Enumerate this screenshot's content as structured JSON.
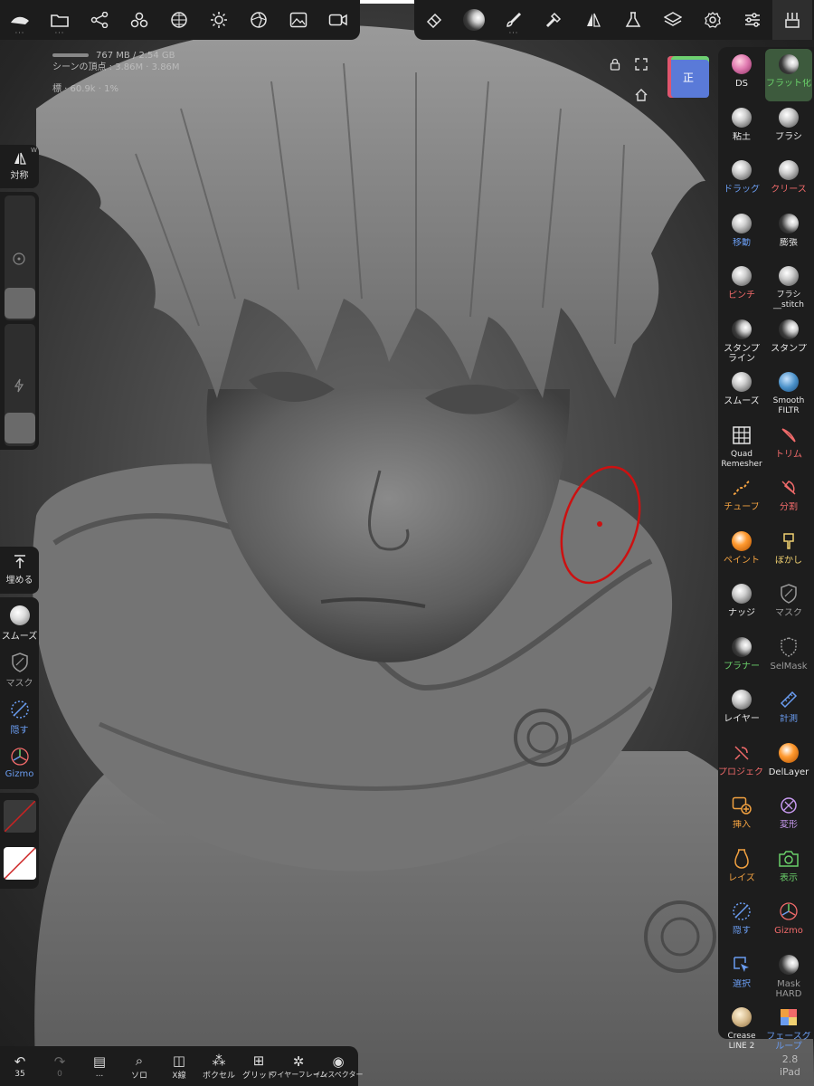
{
  "top_toolbar": {
    "left_buttons": [
      {
        "icon": "nomad-logo-icon",
        "has_more": true
      },
      {
        "icon": "folder-icon",
        "has_more": true
      },
      {
        "icon": "scene-tree-icon",
        "has_more": false
      },
      {
        "icon": "primitives-icon",
        "has_more": false
      },
      {
        "icon": "topology-icon",
        "has_more": false
      },
      {
        "icon": "light-icon",
        "has_more": false
      },
      {
        "icon": "render-icon",
        "has_more": false
      },
      {
        "icon": "background-image-icon",
        "has_more": false
      },
      {
        "icon": "camera-icon",
        "has_more": false
      }
    ],
    "right_buttons": [
      {
        "icon": "eraser-icon",
        "has_more": false
      },
      {
        "icon": "material-sphere-icon",
        "has_more": false
      },
      {
        "icon": "paint-brush-icon",
        "has_more": true
      },
      {
        "icon": "hammer-icon",
        "has_more": false
      },
      {
        "icon": "symmetry-icon",
        "has_more": false
      },
      {
        "icon": "flask-icon",
        "has_more": false
      },
      {
        "icon": "layers-icon",
        "has_more": false
      },
      {
        "icon": "settings-icon",
        "has_more": false
      },
      {
        "icon": "sliders-icon",
        "has_more": false
      },
      {
        "icon": "stroke-settings-icon",
        "has_more": false
      }
    ]
  },
  "stats": {
    "memory": "767 MB / 2.54 GB",
    "vertices_label": "シーンの頂点 : 3.86M · ",
    "vertices_value": "3.86M",
    "mesh": "標 · 60.9k · 1%"
  },
  "view": {
    "cube_label": "正"
  },
  "left_panel": {
    "symmetry_label": "対称",
    "symmetry_badge": "W",
    "fill_label": "埋める",
    "tools": [
      {
        "label": "スムーズ",
        "icon": "smooth-icon"
      },
      {
        "label": "マスク",
        "icon": "mask-icon"
      },
      {
        "label": "隠す",
        "icon": "hide-icon"
      },
      {
        "label": "Gizmo",
        "icon": "gizmo-icon"
      }
    ]
  },
  "right_tools": [
    {
      "label": "DS",
      "color": "#e8e8e8",
      "ball": "pink"
    },
    {
      "label": "フラット化",
      "color": "#6ad06a",
      "ball": "dark",
      "active": true
    },
    {
      "label": "粘土",
      "color": "#e8e8e8",
      "ball": "std"
    },
    {
      "label": "ブラシ",
      "color": "#e8e8e8",
      "ball": "std"
    },
    {
      "label": "ドラッグ",
      "color": "#6a9cf0",
      "ball": "std"
    },
    {
      "label": "クリース",
      "color": "#f06a6a",
      "ball": "std"
    },
    {
      "label": "移動",
      "color": "#6a9cf0",
      "ball": "std"
    },
    {
      "label": "膨張",
      "color": "#e8e8e8",
      "ball": "dark"
    },
    {
      "label": "ピンチ",
      "color": "#f06a6a",
      "ball": "std"
    },
    {
      "label": "ブラシ__stitch",
      "color": "#e8e8e8",
      "ball": "std"
    },
    {
      "label": "スタンプ ライン",
      "color": "#e8e8e8",
      "ball": "dark"
    },
    {
      "label": "スタンプ",
      "color": "#e8e8e8",
      "ball": "dark"
    },
    {
      "label": "スムーズ",
      "color": "#e8e8e8",
      "ball": "std"
    },
    {
      "label": "Smooth FILTR",
      "color": "#e8e8e8",
      "ball": "blue"
    },
    {
      "label": "Quad Remesher",
      "color": "#e8e8e8",
      "ball": "grid"
    },
    {
      "label": "トリム",
      "color": "#f06a6a",
      "ball": "trim"
    },
    {
      "label": "チューブ",
      "color": "#f0a040",
      "ball": "tube"
    },
    {
      "label": "分割",
      "color": "#f06a6a",
      "ball": "split"
    },
    {
      "label": "ペイント",
      "color": "#f0a040",
      "ball": "orange"
    },
    {
      "label": "ぼかし",
      "color": "#f0d070",
      "ball": "smudge"
    },
    {
      "label": "ナッジ",
      "color": "#e8e8e8",
      "ball": "std"
    },
    {
      "label": "マスク",
      "color": "#9a9a9a",
      "ball": "mask"
    },
    {
      "label": "プラナー",
      "color": "#6ad06a",
      "ball": "dark"
    },
    {
      "label": "SelMask",
      "color": "#9a9a9a",
      "ball": "selmask"
    },
    {
      "label": "レイヤー",
      "color": "#e8e8e8",
      "ball": "std"
    },
    {
      "label": "計測",
      "color": "#6a9cf0",
      "ball": "ruler"
    },
    {
      "label": "プロジェクト",
      "color": "#f06a6a",
      "ball": "project"
    },
    {
      "label": "DelLayer",
      "color": "#e8e8e8",
      "ball": "orange"
    },
    {
      "label": "挿入",
      "color": "#f0a040",
      "ball": "insert"
    },
    {
      "label": "変形",
      "color": "#c89af0",
      "ball": "transform"
    },
    {
      "label": "レイズ",
      "color": "#f0a040",
      "ball": "vase"
    },
    {
      "label": "表示",
      "color": "#6ad06a",
      "ball": "camera"
    },
    {
      "label": "隠す",
      "color": "#6a9cf0",
      "ball": "hide"
    },
    {
      "label": "Gizmo",
      "color": "#f06a6a",
      "ball": "gizmo"
    },
    {
      "label": "選択",
      "color": "#6a9cf0",
      "ball": "select"
    },
    {
      "label": "Mask HARD",
      "color": "#9a9a9a",
      "ball": "dark"
    },
    {
      "label": "Crease LINE 2",
      "color": "#e8e8e8",
      "ball": "tan"
    },
    {
      "label": "フェースグループ",
      "color": "#6a9cf0",
      "ball": "facegroup"
    }
  ],
  "bottom_bar": [
    {
      "label": "35",
      "icon": "undo-icon"
    },
    {
      "label": "0",
      "icon": "redo-icon"
    },
    {
      "label": "...",
      "icon": "book-icon"
    },
    {
      "label": "ソロ",
      "icon": "search-icon"
    },
    {
      "label": "X線",
      "icon": "xray-icon"
    },
    {
      "label": "ボクセル",
      "icon": "voxel-icon"
    },
    {
      "label": "グリッド",
      "icon": "grid-icon"
    },
    {
      "label": "ワイヤーフレーム",
      "icon": "wireframe-icon"
    },
    {
      "label": "インスペクター",
      "icon": "inspector-icon"
    }
  ],
  "version": {
    "number": "2.8",
    "device": "iPad"
  }
}
